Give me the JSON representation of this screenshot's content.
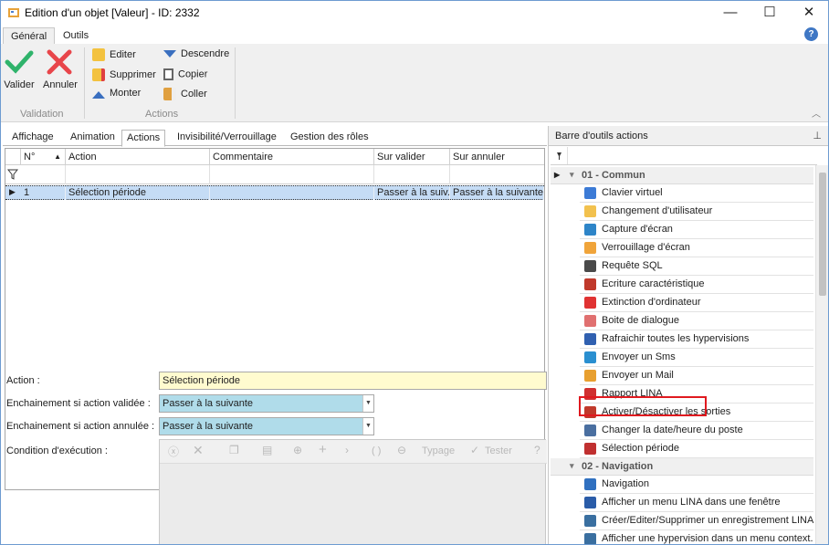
{
  "window": {
    "title": "Edition d'un objet [Valeur] - ID: 2332",
    "minimize": "—",
    "maximize": "☐",
    "close": "✕"
  },
  "ribbon_tabs": [
    {
      "label": "Général"
    },
    {
      "label": "Outils"
    }
  ],
  "help_label": "?",
  "ribbon": {
    "validation": {
      "valider": "Valider",
      "annuler": "Annuler",
      "group_label": "Validation"
    },
    "actions": {
      "editer": "Editer",
      "supprimer": "Supprimer",
      "monter": "Monter",
      "descendre": "Descendre",
      "copier": "Copier",
      "coller": "Coller",
      "group_label": "Actions"
    }
  },
  "panel_tabs": [
    {
      "label": "Affichage"
    },
    {
      "label": "Animation"
    },
    {
      "label": "Actions"
    },
    {
      "label": "Invisibilité/Verrouillage"
    },
    {
      "label": "Gestion des rôles"
    }
  ],
  "grid": {
    "columns": [
      "N°",
      "Action",
      "Commentaire",
      "Sur valider",
      "Sur annuler"
    ],
    "rows": [
      {
        "num": "1",
        "action": "Sélection période",
        "comment": "",
        "sur_valider": "Passer à la suiv...",
        "sur_annuler": "Passer à la suivante"
      }
    ]
  },
  "form": {
    "action_label": "Action :",
    "action_value": "Sélection période",
    "enchainement_valide_label": "Enchainement si action validée :",
    "enchainement_valide_value": "Passer à la suivante",
    "enchainement_annule_label": "Enchainement si action annulée :",
    "enchainement_annule_value": "Passer à la suivante",
    "condition_label": "Condition d'exécution :",
    "condition_toolbar": {
      "typage": "Typage",
      "tester": "Tester",
      "parens": "( )"
    }
  },
  "right_panel": {
    "title": "Barre d'outils actions",
    "groups": [
      {
        "label": "01 - Commun",
        "items": [
          "Clavier virtuel",
          "Changement d'utilisateur",
          "Capture d'écran",
          "Verrouillage d'écran",
          "Requête SQL",
          "Ecriture caractéristique",
          "Extinction d'ordinateur",
          "Boite de dialogue",
          "Rafraichir toutes les hypervisions",
          "Envoyer un Sms",
          "Envoyer un Mail",
          "Rapport LINA",
          "Activer/Désactiver les sorties",
          "Changer la date/heure du poste",
          "Sélection période"
        ]
      },
      {
        "label": "02 - Navigation",
        "items": [
          "Navigation",
          "Afficher un menu LINA dans une fenêtre",
          "Créer/Editer/Supprimer un enregistrement LINA",
          "Afficher une hypervision dans un menu context..."
        ]
      }
    ],
    "highlighted_item": "Sélection période"
  },
  "colors": {
    "accent": "#3f77c4",
    "highlight_border": "#e0191f",
    "selected_row": "#c5dcf5",
    "action_field": "#fffbcf",
    "combo_bg": "#b0dcea"
  },
  "item_icons": [
    "keyboard-icon",
    "user-switch-icon",
    "camera-icon",
    "lock-icon",
    "sql-icon",
    "grid-write-icon",
    "power-icon",
    "dialog-icon",
    "refresh-icon",
    "sms-icon",
    "mail-icon",
    "pdf-icon",
    "toggle-icon",
    "clock-icon",
    "period-icon",
    "arrow-icon",
    "menu-icon",
    "record-icon",
    "hypervision-icon"
  ]
}
